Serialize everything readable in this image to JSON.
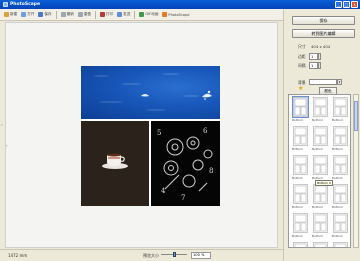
{
  "window": {
    "title": "PhotoScape",
    "minimize": "_",
    "maximize": "□",
    "close": "x"
  },
  "toolbar": {
    "items": [
      {
        "icon": "new-icon",
        "label": "新建",
        "color": "#d9a23b"
      },
      {
        "icon": "open-icon",
        "label": "打开",
        "color": "#6d9ee0"
      },
      {
        "icon": "save-icon",
        "label": "保存",
        "color": "#4a78c7"
      },
      {
        "icon": "undo-icon",
        "label": "撤销",
        "color": "#9aa7b5"
      },
      {
        "icon": "redo-icon",
        "label": "重做",
        "color": "#9aa7b5"
      },
      {
        "icon": "print-icon",
        "label": "打印",
        "color": "#b43b3b"
      },
      {
        "icon": "email-icon",
        "label": "发送",
        "color": "#5b8fd6"
      },
      {
        "icon": "gif-icon",
        "label": "GIF动画",
        "color": "#3f9a4f"
      },
      {
        "icon": "photoscape-icon",
        "label": "PhotoScape",
        "color": "#e37b2c"
      }
    ]
  },
  "status": {
    "text": "1472 mm",
    "zoom_label": "预览大小",
    "zoom_value": "100 %",
    "zoom_fraction": 0.5
  },
  "panel": {
    "save_button": "保存",
    "edit_button": "转到图片编辑",
    "size_label": "尺寸",
    "size_value": "404 x 404",
    "margin_label": "边距",
    "margin_value": "1",
    "spacing_label": "间隔",
    "spacing_value": "1",
    "bg_label": "背景",
    "bg_color": "#ffffff",
    "color_button": "颜色",
    "filter_button": "过滤器",
    "tooltip": "Bottom 2",
    "layouts": [
      "Bottom",
      "Bottom",
      "Bottom",
      "Bottom",
      "Bottom",
      "Bottom",
      "Bottom",
      "Bottom",
      "Bottom",
      "Bottom",
      "Bottom",
      "Bottom",
      "Bottom",
      "Bottom",
      "Bottom",
      "Bottom",
      "Bottom",
      "Bottom"
    ]
  }
}
